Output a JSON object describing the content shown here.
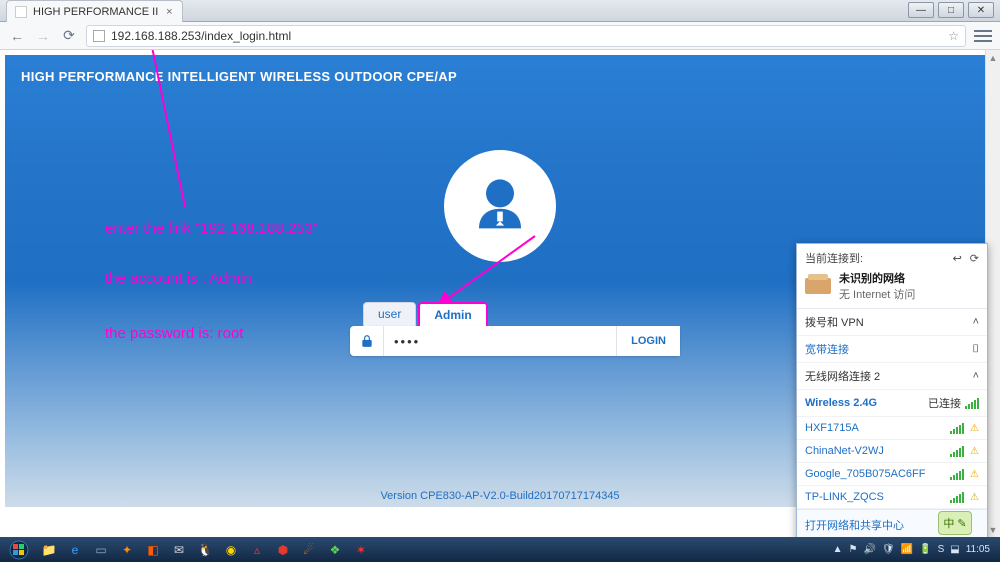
{
  "browser": {
    "tab_title": "HIGH PERFORMANCE II",
    "url": "192.168.188.253/index_login.html",
    "win": {
      "min": "—",
      "max": "□",
      "close": "✕"
    }
  },
  "page": {
    "header": "HIGH PERFORMANCE INTELLIGENT WIRELESS OUTDOOR CPE/AP",
    "tabs": {
      "user": "user",
      "admin": "Admin"
    },
    "password_value": "••••",
    "login_label": "LOGIN",
    "version": "Version CPE830-AP-V2.0-Build20170717174345"
  },
  "annotations": {
    "line1": "enter the link \"192.168.188.253\"",
    "line2": "the account is : Admin",
    "line3": "the password is: root"
  },
  "wifi": {
    "title": "当前连接到:",
    "unknown_name": "未识别的网络",
    "unknown_sub": "无 Internet 访问",
    "dial_header": "拨号和 VPN",
    "dial_item": "宽带连接",
    "wlan_header": "无线网络连接 2",
    "connected_label": "已连接",
    "networks": [
      {
        "name": "Wireless 2.4G",
        "connected": true
      },
      {
        "name": "HXF1715A"
      },
      {
        "name": "ChinaNet-V2WJ"
      },
      {
        "name": "Google_705B075AC6FF"
      },
      {
        "name": "TP-LINK_ZQCS"
      }
    ],
    "footer": "打开网络和共享中心"
  },
  "taskbar": {
    "clock": "11:05",
    "tray_icons": [
      "▲",
      "⚑",
      "🔊",
      "🛡",
      "📶",
      "🔋",
      "S",
      "⬓"
    ],
    "apps": [
      {
        "c": "#ffd400",
        "g": "📁"
      },
      {
        "c": "#3aa0ff",
        "g": "e"
      },
      {
        "c": "#8aa7c7",
        "g": "▭"
      },
      {
        "c": "#ff8a00",
        "g": "✦"
      },
      {
        "c": "#ff5a00",
        "g": "◧"
      },
      {
        "c": "#d6d6d6",
        "g": "✉"
      },
      {
        "c": "#ffffff",
        "g": "🐧"
      },
      {
        "c": "#ffd400",
        "g": "◉"
      },
      {
        "c": "#ff3030",
        "g": "▵"
      },
      {
        "c": "#e23b2e",
        "g": "⬢"
      },
      {
        "c": "#ff8a00",
        "g": "☄"
      },
      {
        "c": "#5bd45b",
        "g": "❖"
      },
      {
        "c": "#ff3030",
        "g": "✶"
      }
    ]
  }
}
